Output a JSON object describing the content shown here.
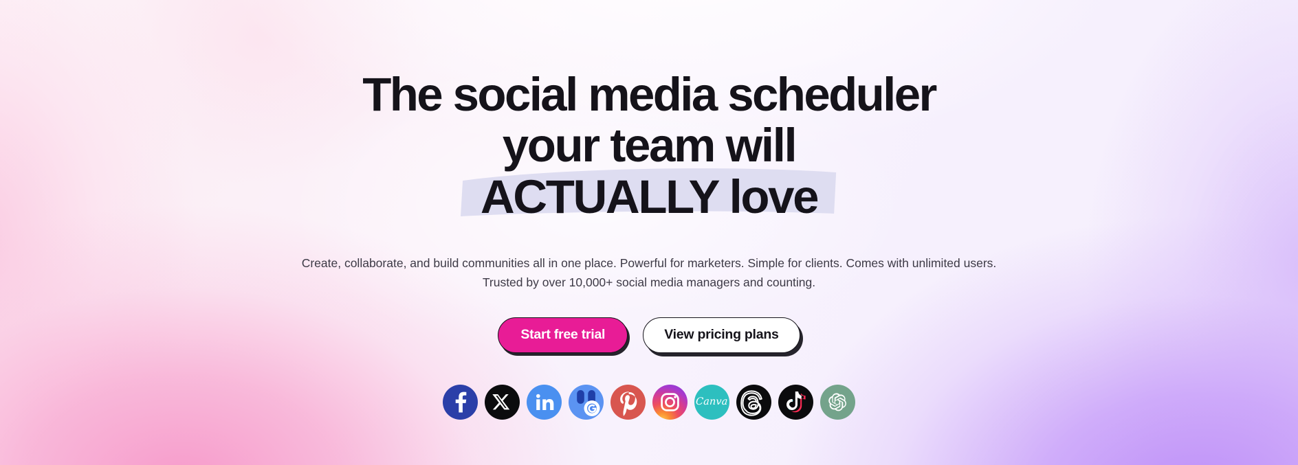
{
  "page": {
    "background": {
      "top_left": "#FDF5F8",
      "top_right": "#F7F3FD",
      "bottom_left": "#F5A8D0",
      "bottom_right": "#C39BF5"
    }
  },
  "hero": {
    "headline": {
      "line1": "The social media scheduler",
      "line2": "your team will",
      "line3": "ACTUALLY love",
      "color": "#15131A",
      "highlight_color": "#DDDCF0"
    },
    "subtitle": {
      "line1": "Create, collaborate, and build communities all in one place. Powerful for marketers. Simple for clients. Comes with unlimited users.",
      "line2": "Trusted by over 10,000+ social media managers and counting.",
      "color": "#3D3A46"
    },
    "cta": {
      "primary": {
        "label": "Start free trial",
        "background": "#E81C96",
        "text_color": "#FFFFFF"
      },
      "secondary": {
        "label": "View pricing plans",
        "background": "#FFFFFF",
        "text_color": "#15131A"
      }
    },
    "social_icons": [
      {
        "name": "facebook",
        "label": "Facebook",
        "color": "#2B3FA8"
      },
      {
        "name": "x",
        "label": "X",
        "color": "#0B0B0D"
      },
      {
        "name": "linkedin",
        "label": "LinkedIn",
        "color": "#4A90F0"
      },
      {
        "name": "google-business-profile",
        "label": "Google Business Profile",
        "color": "#5B93F2"
      },
      {
        "name": "pinterest",
        "label": "Pinterest",
        "color": "#D8564F"
      },
      {
        "name": "instagram",
        "label": "Instagram",
        "color": "#D53C92"
      },
      {
        "name": "canva",
        "label": "Canva",
        "color": "#2DBFBF",
        "wordmark": "Canva"
      },
      {
        "name": "threads",
        "label": "Threads",
        "color": "#0B0B0D"
      },
      {
        "name": "tiktok",
        "label": "TikTok",
        "color": "#0B0B0D"
      },
      {
        "name": "openai",
        "label": "ChatGPT",
        "color": "#74A38B"
      }
    ]
  }
}
